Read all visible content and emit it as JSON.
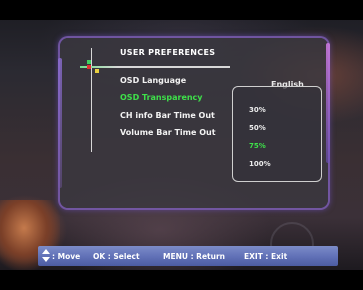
{
  "osd": {
    "title": "USER PREFERENCES",
    "items": [
      {
        "label": "OSD Language",
        "selected": false
      },
      {
        "label": "OSD Transparency",
        "selected": true
      },
      {
        "label": "CH info Bar Time Out",
        "selected": false
      },
      {
        "label": "Volume Bar Time Out",
        "selected": false
      }
    ],
    "language_value": "English",
    "dropdown": {
      "options": [
        "30%",
        "50%",
        "75%",
        "100%"
      ],
      "selected": "75%"
    }
  },
  "help_bar": {
    "move": ": Move",
    "select": "OK : Select",
    "return": "MENU : Return",
    "exit": "EXIT : Exit"
  },
  "colors": {
    "selected_text": "#3ee04a",
    "help_bar": "#6272b8",
    "menu_border": "#7a5ab0"
  },
  "icons": {
    "move": "up-down-arrow-icon"
  }
}
